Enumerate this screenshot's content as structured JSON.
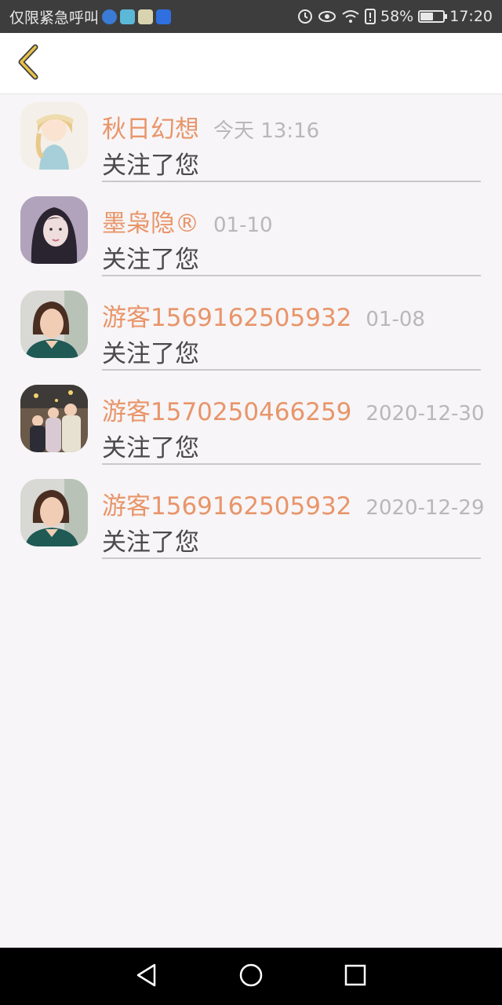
{
  "status_bar": {
    "carrier_text": "仅限紧急呼叫",
    "battery_text": "58%",
    "battery_level": 0.58,
    "time": "17:20",
    "icons": [
      "alarm-icon",
      "eye-icon",
      "wifi-icon",
      "sim-icon",
      "battery-icon"
    ]
  },
  "header": {
    "back_icon": "chevron-left-icon",
    "accent_color": "#e6c24a"
  },
  "notifications": [
    {
      "name": "秋日幻想",
      "time": "今天 13:16",
      "message": "关注了您"
    },
    {
      "name": "墨枭隐®",
      "time": "01-10",
      "message": "关注了您"
    },
    {
      "name": "游客1569162505932",
      "time": "01-08",
      "message": "关注了您"
    },
    {
      "name": "游客1570250466259",
      "time": "2020-12-30",
      "message": "关注了您"
    },
    {
      "name": "游客1569162505932",
      "time": "2020-12-29",
      "message": "关注了您"
    }
  ],
  "colors": {
    "name": "#e8956a",
    "time": "#b8b8b8",
    "message": "#4a4a4a"
  },
  "nav_bar": {
    "buttons": [
      "back-triangle-icon",
      "home-circle-icon",
      "recents-square-icon"
    ]
  }
}
